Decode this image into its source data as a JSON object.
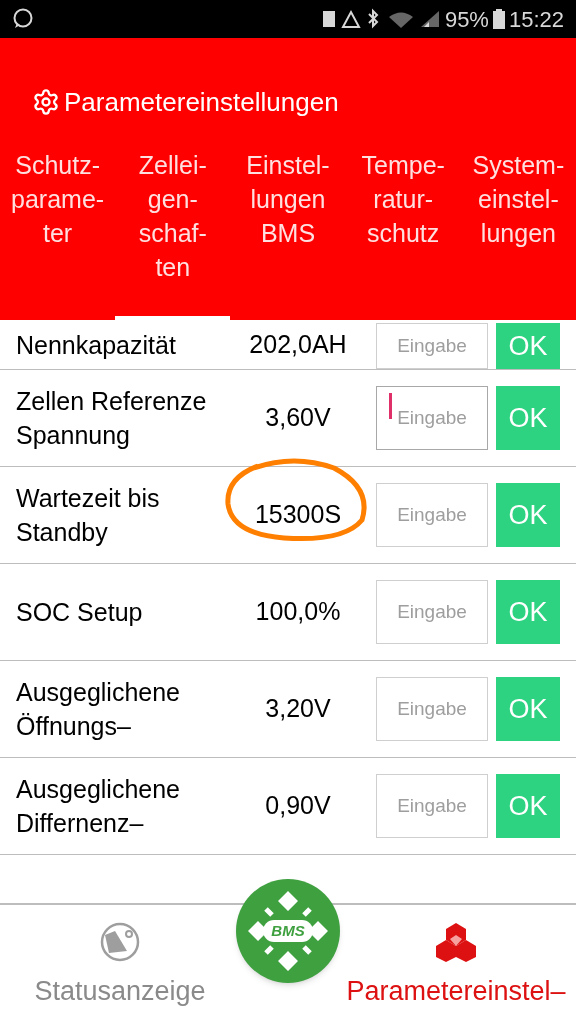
{
  "status_bar": {
    "battery": "95%",
    "time": "15:22"
  },
  "header": {
    "title": "Parametereinstellungen"
  },
  "tabs": [
    {
      "label": "Schutz-\nparame-\nter",
      "selected": false
    },
    {
      "label": "Zellei-\ngen-\nschaf-\nten",
      "selected": true
    },
    {
      "label": "Einstel-\nlungen\nBMS",
      "selected": false
    },
    {
      "label": "Tempe-\nratur-\nschutz",
      "selected": false
    },
    {
      "label": "System-\neinstel-\nlungen",
      "selected": false
    }
  ],
  "rows": [
    {
      "label": "Nennkapazität",
      "value": "202,0AH",
      "placeholder": "Eingabe",
      "button": "OK",
      "focused": false,
      "annotated": false
    },
    {
      "label": "Zellen Referenze Spannung",
      "value": "3,60V",
      "placeholder": "Eingabe",
      "button": "OK",
      "focused": true,
      "annotated": false
    },
    {
      "label": "Wartezeit bis Standby",
      "value": "15300S",
      "placeholder": "Eingabe",
      "button": "OK",
      "focused": false,
      "annotated": true
    },
    {
      "label": "SOC Setup",
      "value": "100,0%",
      "placeholder": "Eingabe",
      "button": "OK",
      "focused": false,
      "annotated": false
    },
    {
      "label": "Ausgeglichene Öffnungs–",
      "value": "3,20V",
      "placeholder": "Eingabe",
      "button": "OK",
      "focused": false,
      "annotated": false
    },
    {
      "label": "Ausgeglichene Differnenz–",
      "value": "0,90V",
      "placeholder": "Eingabe",
      "button": "OK",
      "focused": false,
      "annotated": false
    }
  ],
  "bottom_nav": {
    "center_logo": "BMS",
    "items": [
      {
        "label": "Statusanzeige",
        "kind": "globe",
        "selected": false
      },
      {
        "label": "Parametereinstel–",
        "kind": "cubes",
        "selected": true
      }
    ]
  }
}
